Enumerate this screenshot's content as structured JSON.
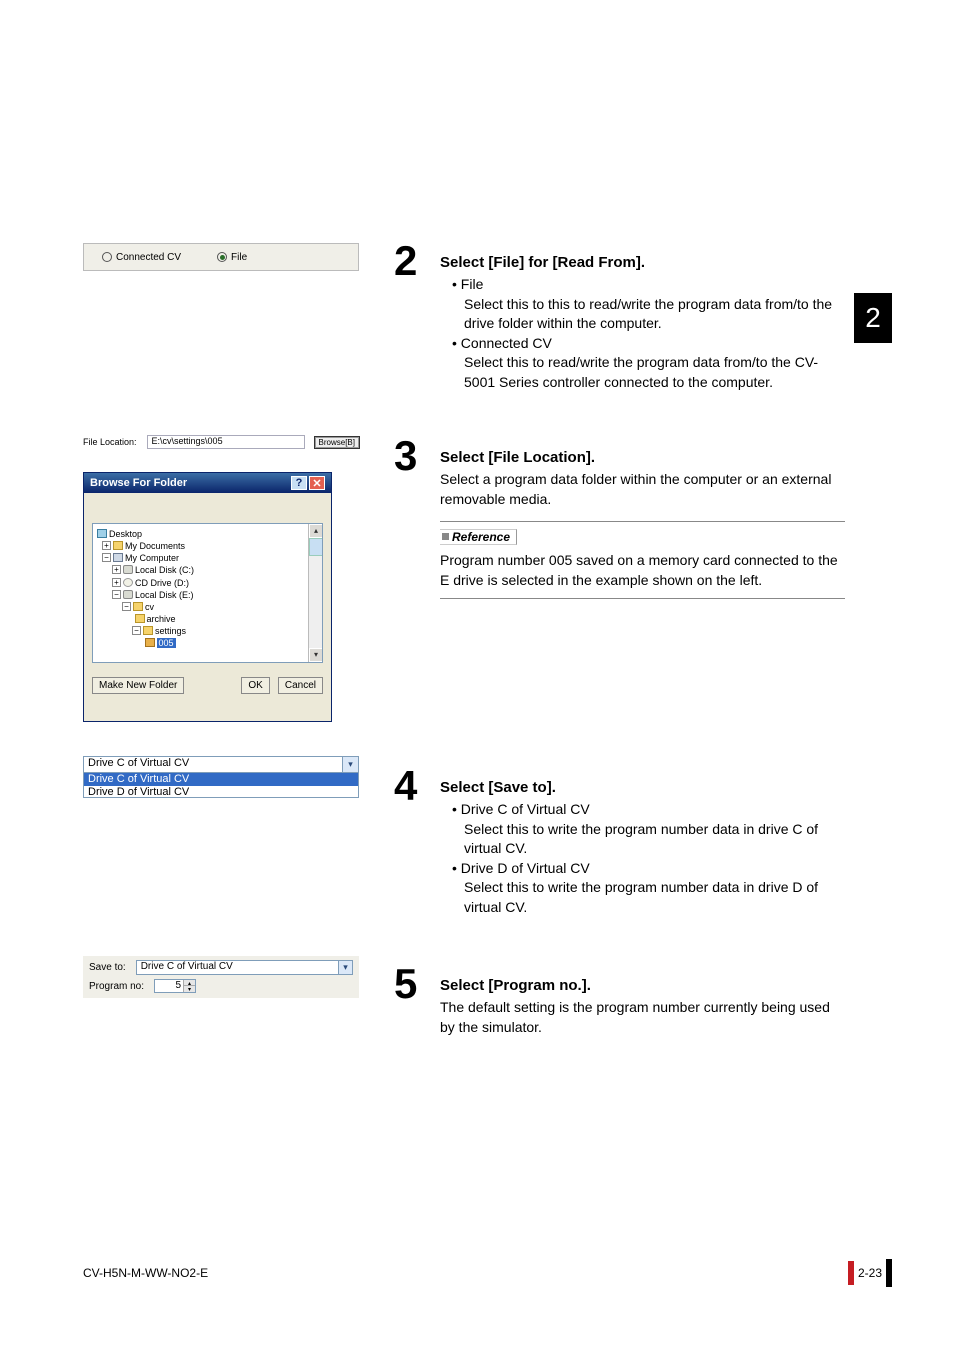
{
  "chapterTab": "2",
  "step2": {
    "num": "2",
    "title": "Select [File] for [Read From].",
    "bullet1": "• File",
    "line1": "Select this to this to read/write the program data from/to the drive folder within the computer.",
    "bullet2": "• Connected CV",
    "line2": "Select this to read/write the program data from/to the CV-5001 Series controller connected to the computer."
  },
  "step3": {
    "num": "3",
    "title": "Select [File Location].",
    "line1": "Select a program data folder within the computer or an external removable media."
  },
  "reference": {
    "label": "Reference",
    "text": "Program number 005 saved on a memory card connected to the E drive is selected in the example shown on the left."
  },
  "step4": {
    "num": "4",
    "title": "Select [Save to].",
    "bullet1": "• Drive C of Virtual CV",
    "line1": "Select this to write the program number data in drive C of virtual CV.",
    "bullet2": "• Drive D of Virtual CV",
    "line2": "Select this to write the program number data in drive D of virtual CV."
  },
  "step5": {
    "num": "5",
    "title": "Select [Program no.].",
    "line1": "The default setting is the program number currently being used by the simulator."
  },
  "shot1": {
    "connected": "Connected CV",
    "file": "File"
  },
  "shot2a": {
    "label": "File Location:",
    "path": "E:\\cv\\settings\\005",
    "browse": "Browse[B]"
  },
  "shot2b": {
    "title": "Browse For Folder",
    "help": "?",
    "close": "✕",
    "desktop": "Desktop",
    "mydocs": "My Documents",
    "mycomp": "My Computer",
    "localC": "Local Disk (C:)",
    "cdD": "CD Drive (D:)",
    "localE": "Local Disk (E:)",
    "cv": "cv",
    "archive": "archive",
    "settings": "settings",
    "sel": "005",
    "mknew": "Make New Folder",
    "ok": "OK",
    "cancel": "Cancel"
  },
  "shot3": {
    "opt1": "Drive C of Virtual CV",
    "opt2": "Drive C of Virtual CV",
    "opt3": "Drive D of Virtual CV"
  },
  "shot4": {
    "saveto": "Save to:",
    "saveval": "Drive C of Virtual CV",
    "progno": "Program no:",
    "progval": "5"
  },
  "footer": {
    "docid": "CV-H5N-M-WW-NO2-E",
    "page": "2-23"
  }
}
